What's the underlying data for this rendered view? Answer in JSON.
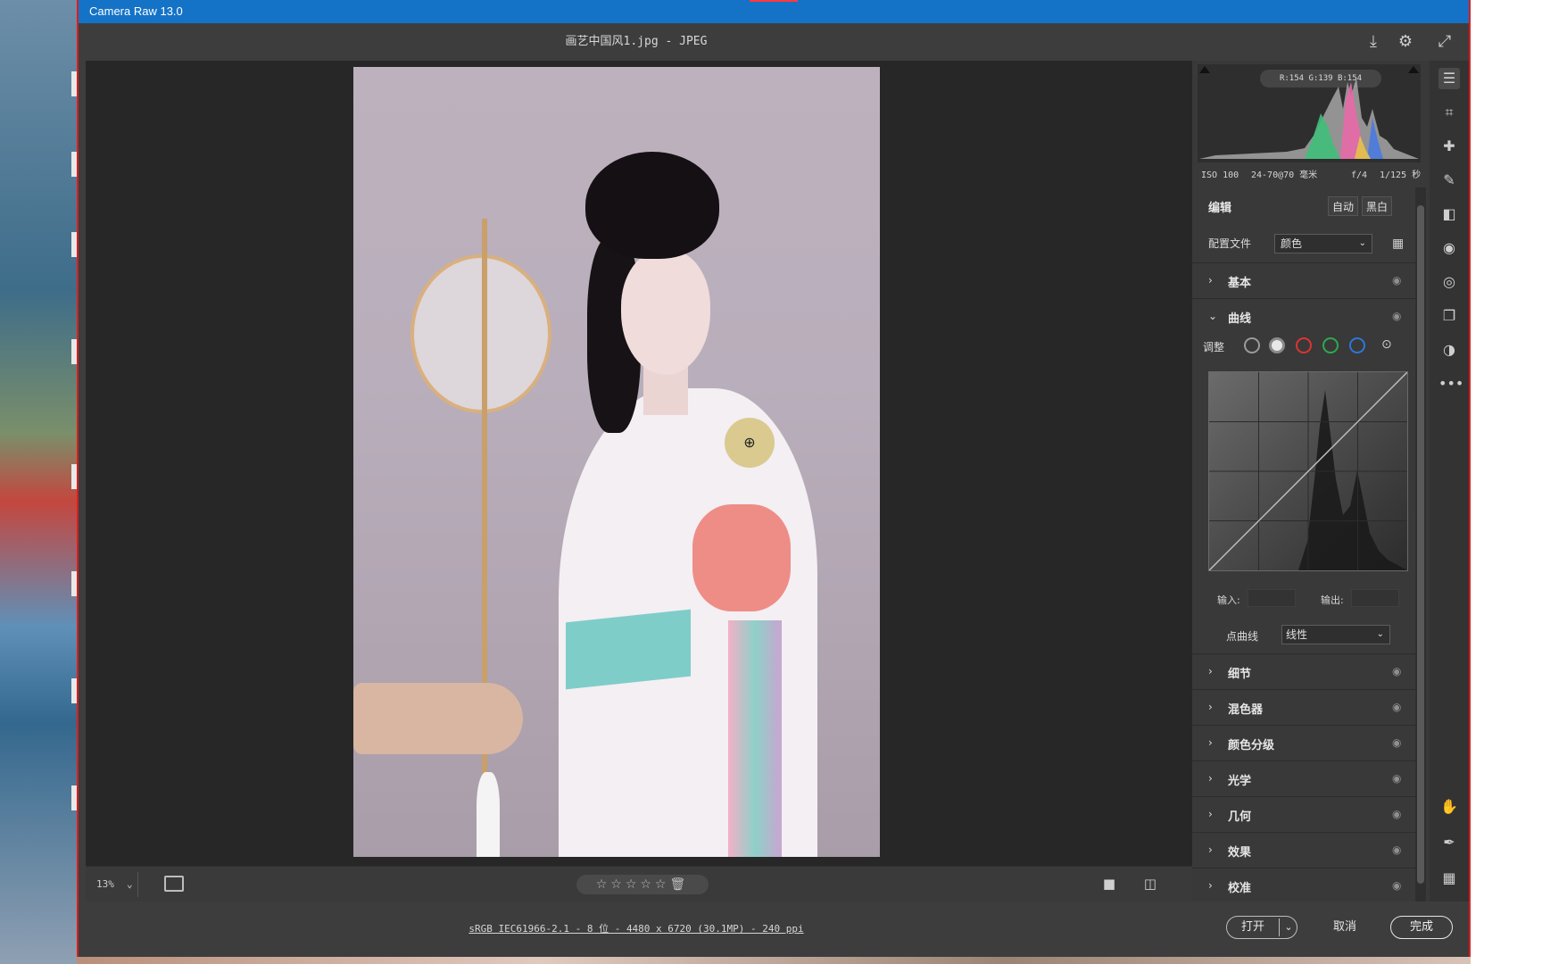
{
  "app": {
    "title": "Camera Raw 13.0",
    "filename": "画艺中国风1.jpg -  JPEG"
  },
  "histogram": {
    "readout": "R:154   G:139   B:154",
    "meta": {
      "iso": "ISO 100",
      "lens": "24-70@70 毫米",
      "aperture": "f/4",
      "shutter": "1/125 秒"
    }
  },
  "edit": {
    "title": "编辑",
    "auto_label": "自动",
    "bw_label": "黑白",
    "profile_label": "配置文件",
    "profile_value": "颜色"
  },
  "sections": {
    "basic": "基本",
    "curve": "曲线",
    "detail": "细节",
    "mixer": "混色器",
    "color_grading": "颜色分级",
    "optics": "光学",
    "geometry": "几何",
    "effects": "效果",
    "calibration": "校准"
  },
  "curve": {
    "adjust_label": "调整",
    "input_label": "输入:",
    "output_label": "输出:",
    "point_curve_label": "点曲线",
    "point_curve_value": "线性"
  },
  "bottombar": {
    "zoom": "13%",
    "rating": "☆☆☆☆☆"
  },
  "footer": {
    "workflow": "sRGB IEC61966-2.1 - 8 位 - 4480 x 6720 (30.1MP) - 240 ppi",
    "open_label": "打开",
    "cancel_label": "取消",
    "done_label": "完成"
  },
  "colors": {
    "titlebar": "#1473c7",
    "accent_red": "#d81e1e"
  },
  "icons": {
    "header": [
      "save-icon",
      "gear-icon",
      "fullscreen-icon"
    ],
    "toolstrip": [
      "edit-sliders-icon",
      "crop-icon",
      "healing-icon",
      "brush-icon",
      "linear-gradient-icon",
      "radial-filter-icon",
      "redeye-icon",
      "snapshots-icon",
      "presets-icon",
      "more-icon",
      "hand-icon",
      "color-sampler-icon",
      "grid-icon"
    ]
  }
}
